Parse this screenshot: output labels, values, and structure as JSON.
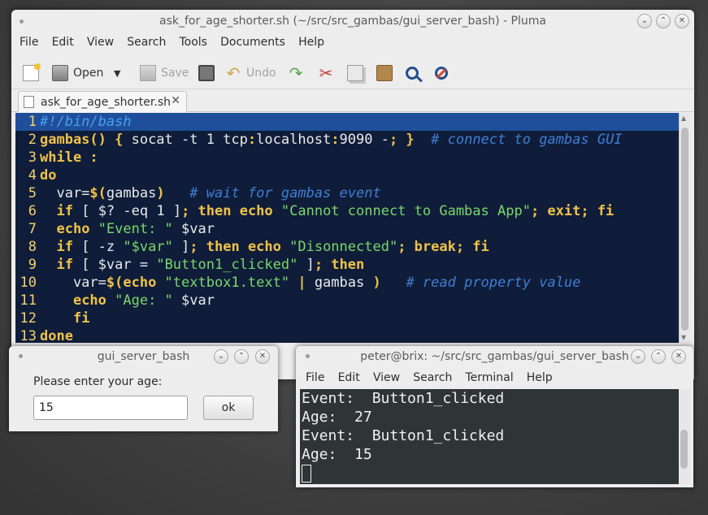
{
  "pluma": {
    "title": "ask_for_age_shorter.sh (~/src/src_gambas/gui_server_bash) - Pluma",
    "menu": [
      "File",
      "Edit",
      "View",
      "Search",
      "Tools",
      "Documents",
      "Help"
    ],
    "toolbar": {
      "open_label": "Open",
      "save_label": "Save",
      "undo_label": "Undo"
    },
    "tab_label": "ask_for_age_shorter.sh",
    "lines": [
      [
        {
          "t": "cm first",
          "v": "#!/bin/bash"
        }
      ],
      [
        {
          "t": "kw",
          "v": "gambas() { "
        },
        {
          "t": "lt",
          "v": "socat -t 1 tcp"
        },
        {
          "t": "kw",
          "v": ":"
        },
        {
          "t": "lt",
          "v": "localhost"
        },
        {
          "t": "kw",
          "v": ":"
        },
        {
          "t": "lt",
          "v": "9090 -"
        },
        {
          "t": "kw",
          "v": "; }"
        },
        {
          "t": "lt",
          "v": "  "
        },
        {
          "t": "cm",
          "v": "# connect to gambas GUI"
        }
      ],
      [
        {
          "t": "kw",
          "v": "while :"
        }
      ],
      [
        {
          "t": "kw",
          "v": "do"
        }
      ],
      [
        {
          "t": "lt",
          "v": "  var="
        },
        {
          "t": "kw",
          "v": "$("
        },
        {
          "t": "lt",
          "v": "gambas"
        },
        {
          "t": "kw",
          "v": ")"
        },
        {
          "t": "lt",
          "v": "   "
        },
        {
          "t": "cm",
          "v": "# wait for gambas event"
        }
      ],
      [
        {
          "t": "lt",
          "v": "  "
        },
        {
          "t": "kw",
          "v": "if"
        },
        {
          "t": "lt",
          "v": " [ "
        },
        {
          "t": "vr",
          "v": "$?"
        },
        {
          "t": "lt",
          "v": " -eq 1 ]"
        },
        {
          "t": "kw",
          "v": "; then echo "
        },
        {
          "t": "st",
          "v": "\"Cannot connect to Gambas App\""
        },
        {
          "t": "kw",
          "v": "; exit; fi"
        }
      ],
      [
        {
          "t": "lt",
          "v": "  "
        },
        {
          "t": "kw",
          "v": "echo "
        },
        {
          "t": "st",
          "v": "\"Event: \""
        },
        {
          "t": "lt",
          "v": " $var"
        }
      ],
      [
        {
          "t": "lt",
          "v": "  "
        },
        {
          "t": "kw",
          "v": "if"
        },
        {
          "t": "lt",
          "v": " [ -z "
        },
        {
          "t": "st",
          "v": "\"$var\""
        },
        {
          "t": "lt",
          "v": " ]"
        },
        {
          "t": "kw",
          "v": "; then echo "
        },
        {
          "t": "st",
          "v": "\"Disonnected\""
        },
        {
          "t": "kw",
          "v": "; break; fi"
        }
      ],
      [
        {
          "t": "lt",
          "v": "  "
        },
        {
          "t": "kw",
          "v": "if"
        },
        {
          "t": "lt",
          "v": " [ $var = "
        },
        {
          "t": "st",
          "v": "\"Button1_clicked\""
        },
        {
          "t": "lt",
          "v": " ]"
        },
        {
          "t": "kw",
          "v": "; then"
        }
      ],
      [
        {
          "t": "lt",
          "v": "    var="
        },
        {
          "t": "kw",
          "v": "$(echo "
        },
        {
          "t": "st",
          "v": "\"textbox1.text\""
        },
        {
          "t": "lt",
          "v": " "
        },
        {
          "t": "kw",
          "v": "|"
        },
        {
          "t": "lt",
          "v": " gambas "
        },
        {
          "t": "kw",
          "v": ")"
        },
        {
          "t": "lt",
          "v": "   "
        },
        {
          "t": "cm",
          "v": "# read property value"
        }
      ],
      [
        {
          "t": "lt",
          "v": "    "
        },
        {
          "t": "kw",
          "v": "echo "
        },
        {
          "t": "st",
          "v": "\"Age: \""
        },
        {
          "t": "lt",
          "v": " $var"
        }
      ],
      [
        {
          "t": "lt",
          "v": "    "
        },
        {
          "t": "kw",
          "v": "fi"
        }
      ],
      [
        {
          "t": "kw",
          "v": "done"
        }
      ]
    ]
  },
  "dialog": {
    "title": "gui_server_bash",
    "prompt": "Please enter your age:",
    "input_value": "15",
    "ok_label": "ok"
  },
  "terminal": {
    "title": "peter@brix: ~/src/src_gambas/gui_server_bash",
    "menu": [
      "File",
      "Edit",
      "View",
      "Search",
      "Terminal",
      "Help"
    ],
    "lines": [
      "Event:  Button1_clicked",
      "Age:  27",
      "Event:  Button1_clicked",
      "Age:  15"
    ]
  }
}
